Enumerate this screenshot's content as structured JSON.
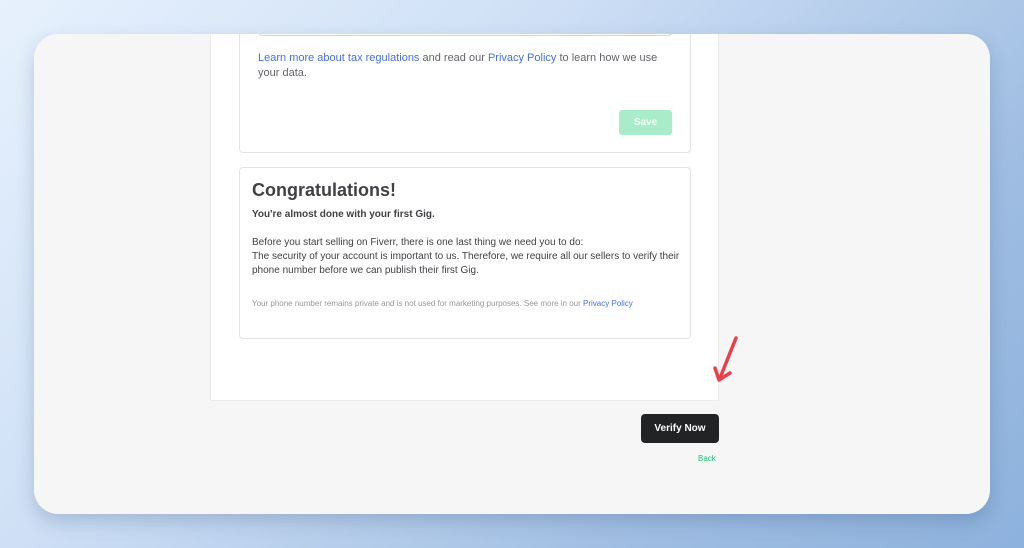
{
  "tax_section": {
    "learn_more_link": "Learn more about tax regulations",
    "text_middle": " and read our ",
    "privacy_link": "Privacy Policy",
    "text_end": " to learn how we use your data.",
    "save_label": "Save"
  },
  "congrats": {
    "title": "Congratulations!",
    "subtitle": "You're almost done with your first Gig.",
    "body_line1": "Before you start selling on Fiverr, there is one last thing we need you to do:",
    "body_line2": "The security of your account is important to us. Therefore, we require all our sellers to verify their phone number before we can publish their first Gig.",
    "privacy_note": "Your phone number remains private and is not used for marketing purposes. See more in our ",
    "privacy_link": "Privacy Policy"
  },
  "actions": {
    "verify_label": "Verify Now",
    "back_label": "Back"
  },
  "colors": {
    "link": "#446ee7",
    "save_disabled": "#a9ecca",
    "verify_bg": "#222325",
    "back": "#1dbf73",
    "annotation_arrow": "#e8404a"
  },
  "icons": {
    "annotation": "arrow-pointer-icon"
  }
}
